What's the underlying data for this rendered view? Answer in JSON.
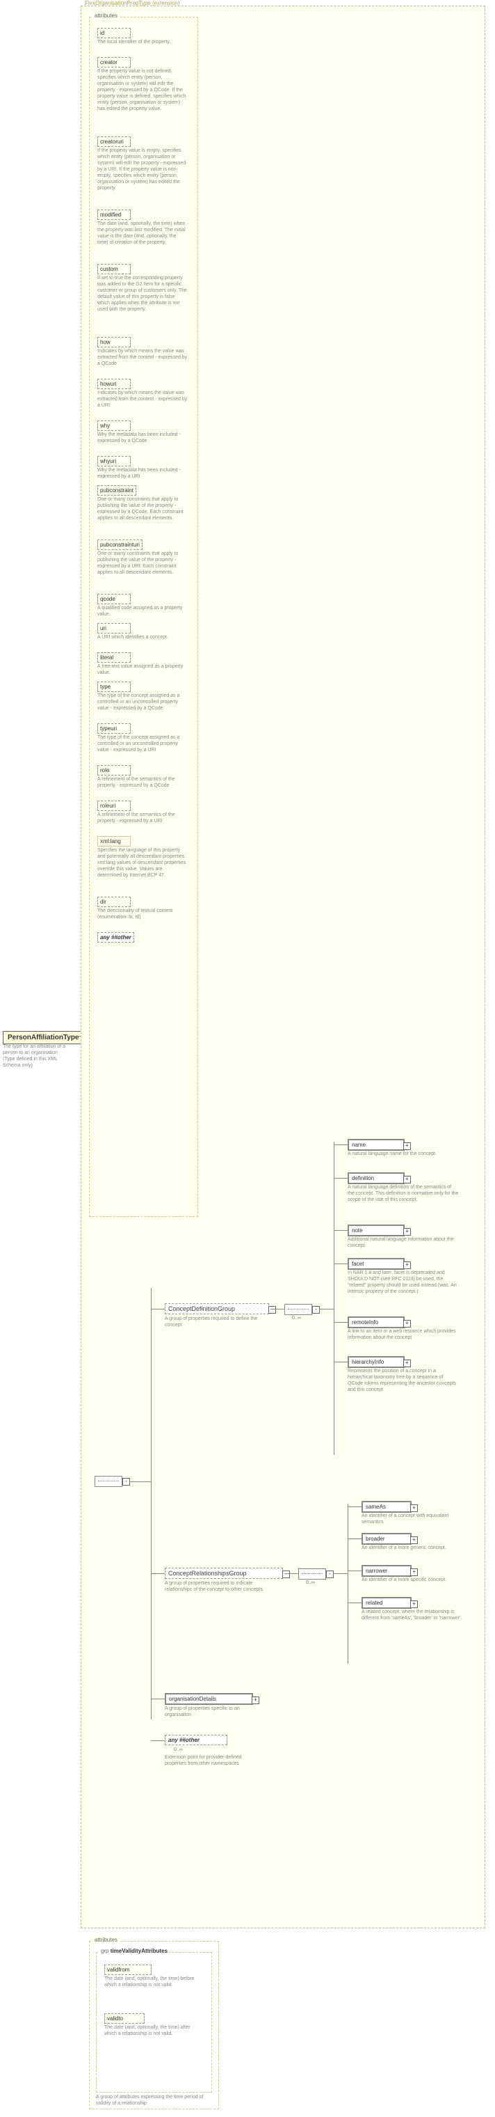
{
  "root": {
    "type": "PersonAffiliationType",
    "desc": "The type for an afflilation of a person to an organisation (Type defined in this XML Schema only)"
  },
  "ext": {
    "label": "FlexOrganisationPropType (extension)"
  },
  "attrSection": "attributes",
  "attrs": [
    {
      "name": "id",
      "desc": "The local identifier of the property.",
      "dashed": true
    },
    {
      "name": "creator",
      "desc": "If the property value is not defined, specifies which entity (person, organisation or system) will edit the property - expressed by a QCode. If the property value is defined, specifies which entity (person, organisation or system) has edited the property value.",
      "dashed": true
    },
    {
      "name": "creatoruri",
      "desc": "If the property value is empty, specifies which entity (person, organisation or system) will edit the property - expressed by a URI. If the property value is non-empty, specifies which entity (person, organisation or system) has edited the property.",
      "dashed": true
    },
    {
      "name": "modified",
      "desc": "The date (and, optionally, the time) when the property was last modified. The initial value is the date (and, optionally, the time) of creation of the property.",
      "dashed": true
    },
    {
      "name": "custom",
      "desc": "If set to true the corresponding property was added to the G2 Item for a specific customer or group of customers only. The default value of this property is false which applies when the attribute is not used with the property.",
      "dashed": true
    },
    {
      "name": "how",
      "desc": "Indicates by which means the value was extracted from the content - expressed by a QCode",
      "dashed": true
    },
    {
      "name": "howuri",
      "desc": "Indicates by which means the value was extracted from the content - expressed by a URI",
      "dashed": true
    },
    {
      "name": "why",
      "desc": "Why the metadata has been included - expressed by a QCode",
      "dashed": true
    },
    {
      "name": "whyuri",
      "desc": "Why the metadata has been included - expressed by a URI",
      "dashed": true
    },
    {
      "name": "pubconstraint",
      "desc": "One or many constraints that apply to publishing the value of the property - expressed by a QCode. Each constraint applies to all descendant elements.",
      "dashed": true
    },
    {
      "name": "pubconstrainturi",
      "desc": "One or many constraints that apply to publishing the value of the property - expressed by a URI. Each constraint applies to all descendant elements.",
      "dashed": true
    },
    {
      "name": "qcode",
      "desc": "A qualified code assigned as a property value.",
      "dashed": true
    },
    {
      "name": "uri",
      "desc": "A URI which identifies a concept.",
      "dashed": true
    },
    {
      "name": "literal",
      "desc": "A free-text value assigned as a property value.",
      "dashed": true
    },
    {
      "name": "type",
      "desc": "The type of the concept assigned as a controlled or an uncontrolled property value - expressed by a QCode",
      "dashed": true
    },
    {
      "name": "typeuri",
      "desc": "The type of the concept assigned as a controlled or an uncontrolled property value - expressed by a URI",
      "dashed": true
    },
    {
      "name": "role",
      "desc": "A refinement of the semantics of the property - expressed by a QCode",
      "dashed": true
    },
    {
      "name": "roleuri",
      "desc": "A refinement of the semantics of the property - expressed by a URI",
      "dashed": true
    },
    {
      "name": "xml:lang",
      "desc": "Specifies the language of this property and potentially all descendant properties. xml:lang values of descendant properties override this value. Values are determined by Internet BCP 47.",
      "dashed": true,
      "solid": true
    },
    {
      "name": "dir",
      "desc": "The directionality of textual content (enumeration: ltr, rtl)",
      "dashed": true
    },
    {
      "name": "any ##other",
      "desc": "",
      "any": true
    }
  ],
  "cdg": {
    "label": "ConceptDefinitionGroup",
    "desc": "A group of properties required to define the concept",
    "card": "0..∞",
    "children": [
      {
        "name": "name",
        "desc": "A natural language name for the concept."
      },
      {
        "name": "definition",
        "desc": "A natural language definition of the semantics of the concept. This definition is normative only for the scope of the use of this concept."
      },
      {
        "name": "note",
        "desc": "Additional natural language information about the concept."
      },
      {
        "name": "facet",
        "desc": "In NAR 1.8 and later, facet is deprecated and SHOULD NOT (see RFC 2119) be used, the \"related\" property should be used instead.(was: An intrinsic property of the concept.)"
      },
      {
        "name": "remoteInfo",
        "desc": "A link to an item or a web resource which provides information about the concept"
      },
      {
        "name": "hierarchyInfo",
        "desc": "Represents the position of a concept in a hierarchical taxonomy tree by a sequence of QCode tokens representing the ancestor concepts and this concept"
      }
    ]
  },
  "crg": {
    "label": "ConceptRelationshipsGroup",
    "desc": "A group of properties required to indicate relationships of the concept to other concepts",
    "card": "0..∞",
    "children": [
      {
        "name": "sameAs",
        "desc": "An identifier of a concept with equivalent semantics"
      },
      {
        "name": "broader",
        "desc": "An identifier of a more generic concept."
      },
      {
        "name": "narrower",
        "desc": "An identifier of a more specific concept."
      },
      {
        "name": "related",
        "desc": "A related concept, where the relationship is different from 'sameAs', 'broader' or 'narrower'."
      }
    ]
  },
  "orgDetails": {
    "name": "organisationDetails",
    "desc": "A group of properties specific to an organisation"
  },
  "anyOther": {
    "name": "any ##other",
    "desc": "Extension point for provider-defined properties from other namespaces",
    "card": "0..∞"
  },
  "validity": {
    "attrSection": "attributes",
    "grp": "timeValidityAttributes",
    "attrs": [
      {
        "name": "validfrom",
        "desc": "The date (and, optionally, the time) before which a relationship is not valid."
      },
      {
        "name": "validto",
        "desc": "The date (and, optionally, the time) after which a relationship is not valid."
      }
    ],
    "desc": "A group of attributes expressing the time period of validity of a relationship"
  },
  "chart_data": {
    "type": "diagram",
    "note": "XML Schema documentation tree (XMLSpy-style), no numeric chart data"
  }
}
